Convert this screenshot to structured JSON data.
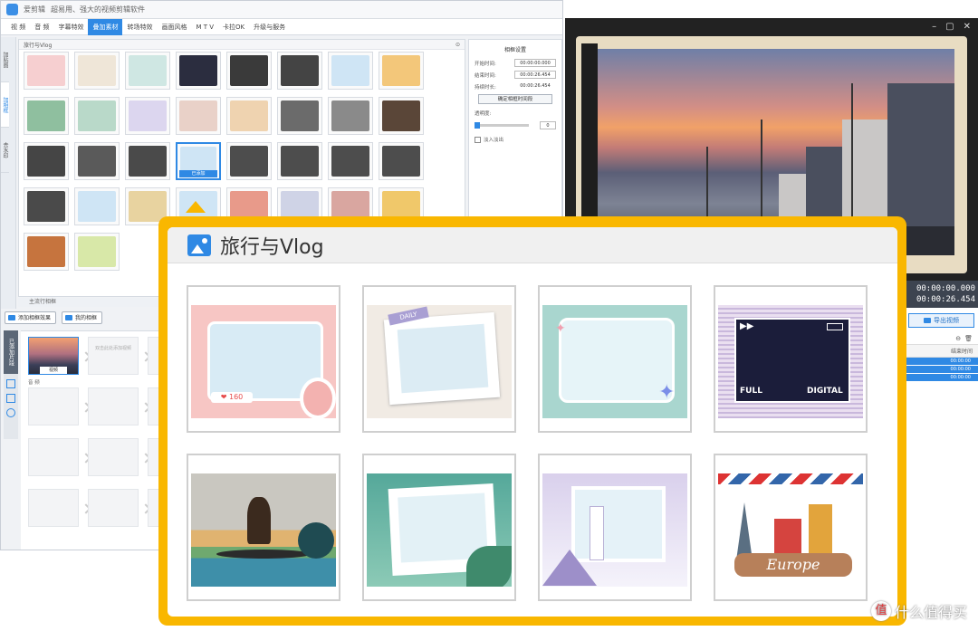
{
  "titlebar": {
    "app_name": "爱剪辑",
    "slogan": "超易用、强大的视频剪辑软件"
  },
  "menu": [
    "视 频",
    "音 频",
    "字幕特效",
    "叠加素材",
    "转场特效",
    "画面风格",
    "M T V",
    "卡拉OK",
    "升级与服务"
  ],
  "side_tabs": [
    "加贴图",
    "加相框",
    "去水印"
  ],
  "grid_panel": {
    "header": "旅行与Vlog",
    "selected_tag": "已添加"
  },
  "props": {
    "header": "相框设置",
    "start_label": "开始时间:",
    "start_value": "00:00:00.000",
    "end_label": "结束时间:",
    "end_value": "00:00:26.454",
    "duration_label": "持续时长:",
    "duration_value": "00:00:26.454",
    "button": "确定相框时间段",
    "opacity_label": "透明度:",
    "opacity_value": "0",
    "fade_label": "淡入淡出"
  },
  "subhead": "主流行相框",
  "buttons": {
    "add_effect": "添加相框效果",
    "my_frames": "我的相框"
  },
  "timeline": {
    "side_label": "已添加片段",
    "clip_caption": "视频",
    "placeholder": "双击此处添加视频",
    "row2_label": "音 频"
  },
  "time_panel": {
    "time1": "00:00:00.000",
    "time2": "00:00:26.454",
    "export_label": "导出视频",
    "col_header": "结束时间",
    "rows": [
      "00:00:00",
      "00:00:00",
      "00:00:00"
    ]
  },
  "window_controls": [
    "–",
    "▢",
    "✕"
  ],
  "overlay": {
    "title": "旅行与Vlog"
  },
  "cards": [
    {
      "id": "pink-phone-frame",
      "labels": [
        "❤ 160"
      ]
    },
    {
      "id": "daily-photo-frame",
      "labels": [
        "DAILY"
      ]
    },
    {
      "id": "mint-sparkle-frame",
      "labels": []
    },
    {
      "id": "digital-full-frame",
      "labels": [
        "FULL",
        "DIGITAL"
      ]
    },
    {
      "id": "surfer-frame",
      "labels": []
    },
    {
      "id": "green-tropical-frame",
      "labels": []
    },
    {
      "id": "snow-church-frame",
      "labels": []
    },
    {
      "id": "europe-travel-frame",
      "labels": [
        "Europe"
      ]
    }
  ],
  "watermark": {
    "text": "什么值得买",
    "mark": "值"
  },
  "colors": {
    "accent": "#2f89e4",
    "overlay_border": "#f9b700"
  }
}
